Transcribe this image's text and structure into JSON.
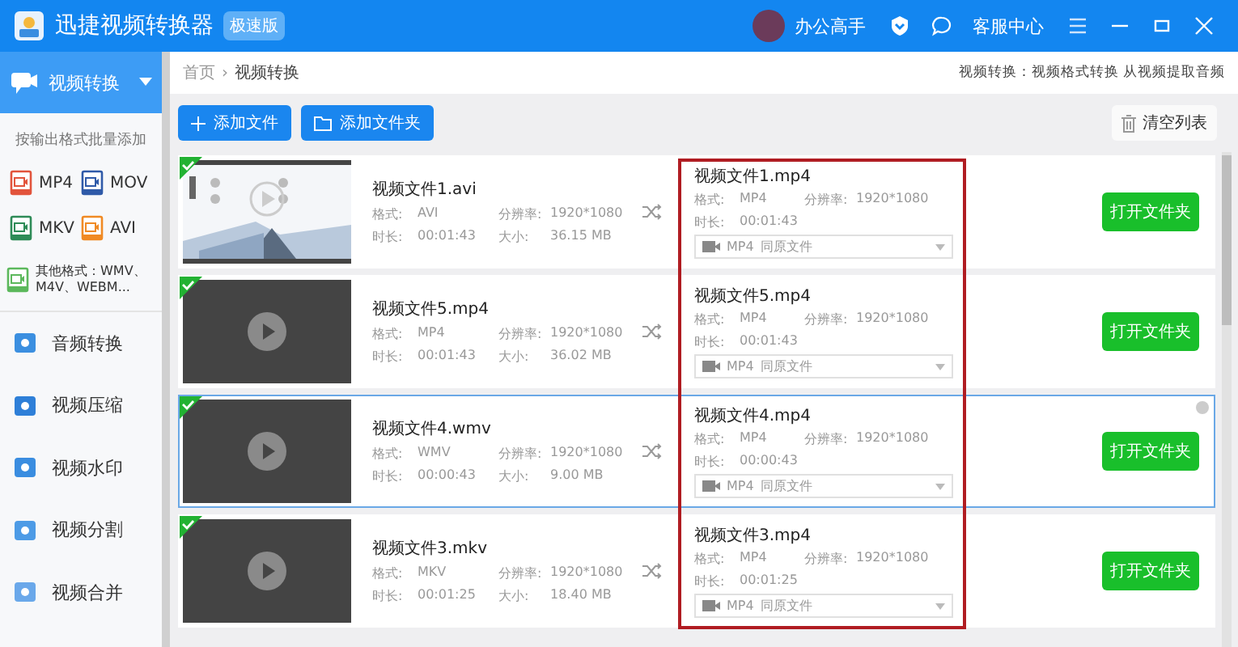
{
  "title_bar": {
    "app_name": "迅捷视频转换器",
    "edition_badge": "极速版",
    "user_name": "办公高手",
    "service_label": "客服中心"
  },
  "sidebar": {
    "active_section": {
      "label": "视频转换",
      "expanded": true
    },
    "hint": "按输出格式批量添加",
    "formats": [
      {
        "label": "MP4",
        "color": "#e2543c"
      },
      {
        "label": "MOV",
        "color": "#2f5aa8"
      },
      {
        "label": "MKV",
        "color": "#2e8b57"
      },
      {
        "label": "AVI",
        "color": "#f08a24"
      }
    ],
    "other_formats": {
      "label": "其他格式：WMV、M4V、WEBM...",
      "color": "#5cb85c"
    },
    "items": [
      {
        "label": "音频转换"
      },
      {
        "label": "视频压缩"
      },
      {
        "label": "视频水印"
      },
      {
        "label": "视频分割"
      },
      {
        "label": "视频合并"
      }
    ]
  },
  "breadcrumb": {
    "home": "首页",
    "separator": "›",
    "current": "视频转换"
  },
  "info_text": "视频转换：视频格式转换 从视频提取音频",
  "toolbar": {
    "add_file": "添加文件",
    "add_folder": "添加文件夹",
    "clear": "清空列表"
  },
  "files": [
    {
      "name": "视频文件1.avi",
      "labels": {
        "format": "格式:",
        "resolution": "分辨率:",
        "duration": "时长:",
        "size": "大小:"
      },
      "format": "AVI",
      "resolution": "1920*1080",
      "duration": "00:01:43",
      "size": "36.15 MB",
      "checked": true,
      "selected": false,
      "output": {
        "name": "视频文件1.mp4",
        "labels": {
          "format": "格式:",
          "resolution": "分辨率:",
          "duration": "时长:"
        },
        "format": "MP4",
        "resolution": "1920*1080",
        "duration": "00:01:43",
        "preset": "MP4",
        "target": "同原文件"
      },
      "action": "打开文件夹"
    },
    {
      "name": "视频文件5.mp4",
      "labels": {
        "format": "格式:",
        "resolution": "分辨率:",
        "duration": "时长:",
        "size": "大小:"
      },
      "format": "MP4",
      "resolution": "1920*1080",
      "duration": "00:01:43",
      "size": "36.02 MB",
      "thumbnail": {
        "kind": "blank"
      },
      "checked": true,
      "selected": false,
      "output": {
        "name": "视频文件5.mp4",
        "labels": {
          "format": "格式:",
          "resolution": "分辨率:",
          "duration": "时长:"
        },
        "format": "MP4",
        "resolution": "1920*1080",
        "duration": "00:01:43",
        "preset": "MP4",
        "target": "同原文件"
      },
      "action": "打开文件夹"
    },
    {
      "name": "视频文件4.wmv",
      "labels": {
        "format": "格式:",
        "resolution": "分辨率:",
        "duration": "时长:",
        "size": "大小:"
      },
      "format": "WMV",
      "resolution": "1920*1080",
      "duration": "00:00:43",
      "size": "9.00 MB",
      "thumbnail": {
        "kind": "blank"
      },
      "checked": true,
      "selected": true,
      "output": {
        "name": "视频文件4.mp4",
        "labels": {
          "format": "格式:",
          "resolution": "分辨率:",
          "duration": "时长:"
        },
        "format": "MP4",
        "resolution": "1920*1080",
        "duration": "00:00:43",
        "preset": "MP4",
        "target": "同原文件"
      },
      "action": "打开文件夹"
    },
    {
      "name": "视频文件3.mkv",
      "labels": {
        "format": "格式:",
        "resolution": "分辨率:",
        "duration": "时长:",
        "size": "大小:"
      },
      "format": "MKV",
      "resolution": "1920*1080",
      "duration": "00:01:25",
      "size": "18.40 MB",
      "thumbnail": {
        "kind": "blank"
      },
      "checked": true,
      "selected": false,
      "output": {
        "name": "视频文件3.mp4",
        "labels": {
          "format": "格式:",
          "resolution": "分辨率:",
          "duration": "时长:"
        },
        "format": "MP4",
        "resolution": "1920*1080",
        "duration": "00:01:25",
        "preset": "MP4",
        "target": "同原文件"
      },
      "action": "打开文件夹"
    }
  ]
}
